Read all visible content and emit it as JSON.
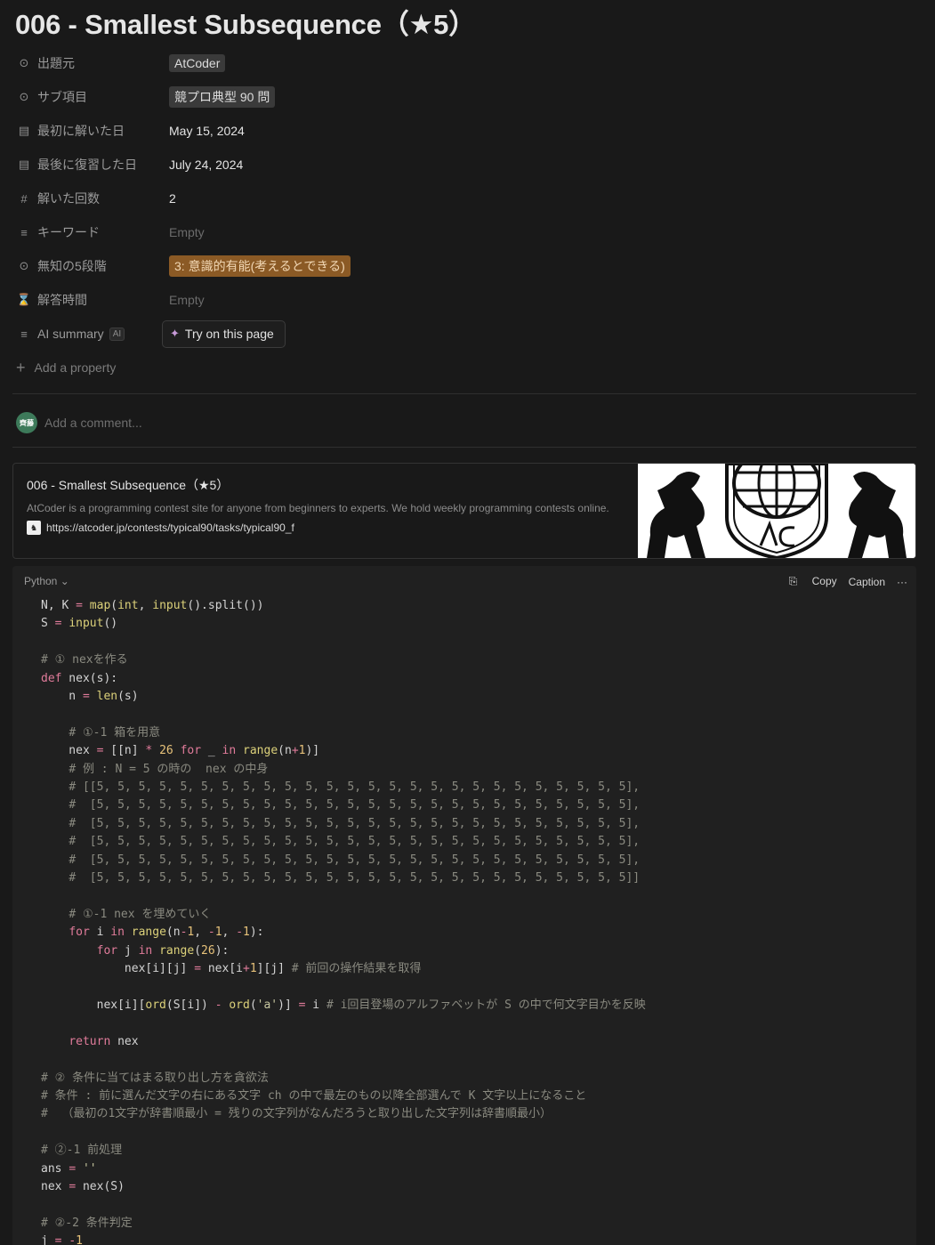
{
  "page": {
    "title": "006 - Smallest Subsequence（★5）"
  },
  "properties": [
    {
      "name": "出題元",
      "icon": "select-icon",
      "value": "AtCoder",
      "kind": "tag"
    },
    {
      "name": "サブ項目",
      "icon": "select-icon",
      "value": "競プロ典型 90 問",
      "kind": "tag"
    },
    {
      "name": "最初に解いた日",
      "icon": "calendar-icon",
      "value": "May 15, 2024",
      "kind": "text"
    },
    {
      "name": "最後に復習した日",
      "icon": "calendar-icon",
      "value": "July 24, 2024",
      "kind": "text"
    },
    {
      "name": "解いた回数",
      "icon": "hash-icon",
      "value": "2",
      "kind": "text"
    },
    {
      "name": "キーワード",
      "icon": "text-icon",
      "value": "Empty",
      "kind": "empty"
    },
    {
      "name": "無知の5段階",
      "icon": "select-icon",
      "value": "3: 意識的有能(考えるとできる)",
      "kind": "tag-orange"
    },
    {
      "name": "解答時間",
      "icon": "timer-icon",
      "value": "Empty",
      "kind": "empty"
    }
  ],
  "ai_summary": {
    "name": "AI summary",
    "badge": "AI",
    "button": "Try on this page"
  },
  "add_property": "Add a property",
  "comment": {
    "avatar": "齊藤",
    "placeholder": "Add a comment..."
  },
  "bookmark": {
    "title": "006 - Smallest Subsequence（★5）",
    "description": "AtCoder is a programming contest site for anyone from beginners to experts. We hold weekly programming contests online.",
    "url": "https://atcoder.jp/contests/typical90/tasks/typical90_f"
  },
  "code_block": {
    "language": "Python",
    "copy_label": "Copy",
    "caption_label": "Caption",
    "more_label": "···"
  }
}
